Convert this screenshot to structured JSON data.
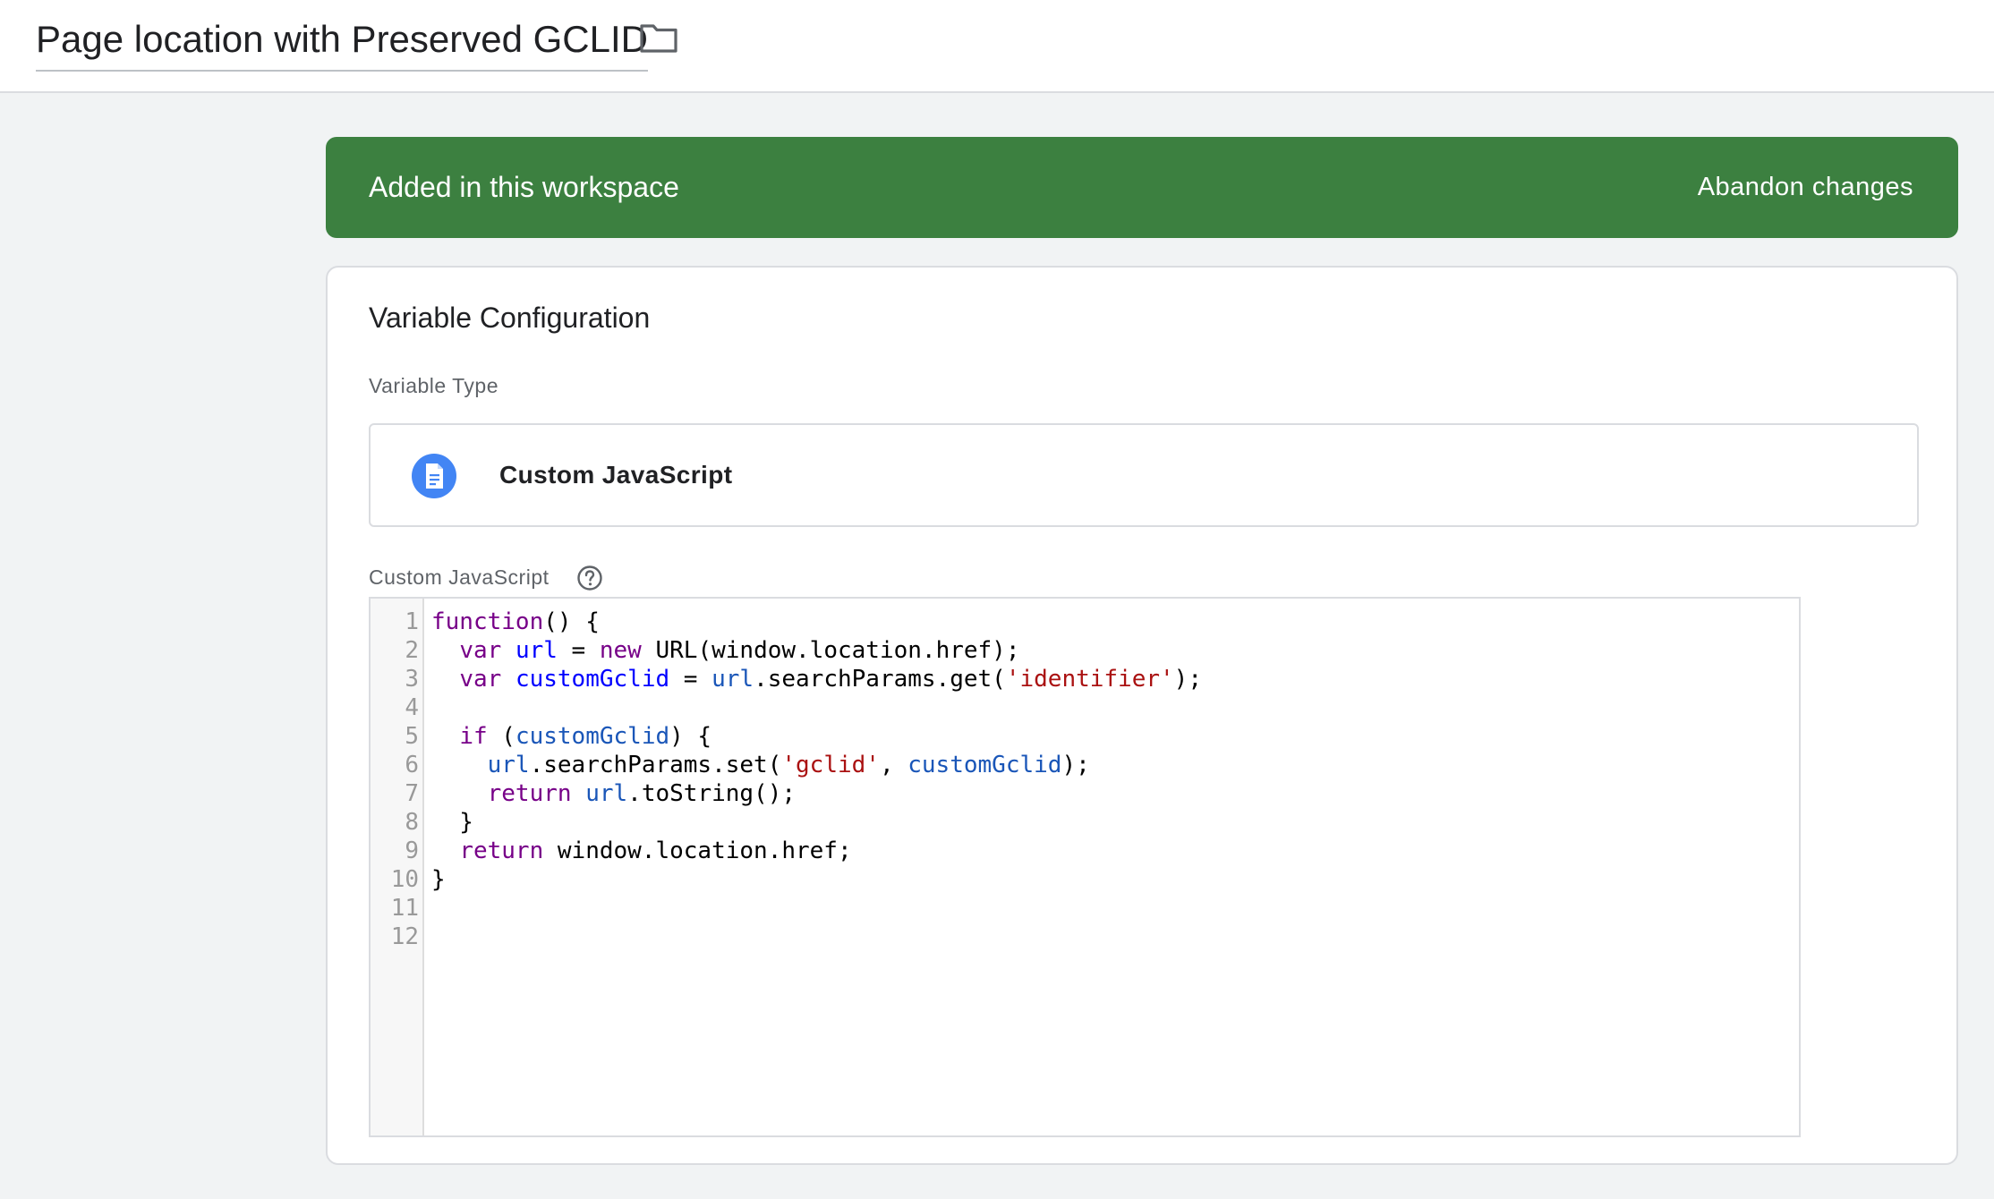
{
  "header": {
    "title": "Page location with Preserved GCLID",
    "folder_icon": "folder-icon"
  },
  "banner": {
    "status_text": "Added in this workspace",
    "abandon_label": "Abandon changes",
    "color": "#3c8040"
  },
  "config": {
    "title": "Variable Configuration",
    "type_label": "Variable Type",
    "type_name": "Custom JavaScript",
    "type_icon": "document-icon",
    "type_icon_color": "#4285f4",
    "js_label": "Custom JavaScript",
    "help_icon": "help-icon"
  },
  "editor": {
    "line_numbers": [
      "1",
      "2",
      "3",
      "4",
      "5",
      "6",
      "7",
      "8",
      "9",
      "10",
      "11",
      "12"
    ],
    "lines": [
      [
        [
          "keyword",
          "function"
        ],
        [
          "plain",
          "() {"
        ]
      ],
      [
        [
          "plain",
          "  "
        ],
        [
          "keyword",
          "var"
        ],
        [
          "plain",
          " "
        ],
        [
          "def",
          "url"
        ],
        [
          "plain",
          " = "
        ],
        [
          "keyword",
          "new"
        ],
        [
          "plain",
          " URL(window.location.href);"
        ]
      ],
      [
        [
          "plain",
          "  "
        ],
        [
          "keyword",
          "var"
        ],
        [
          "plain",
          " "
        ],
        [
          "def",
          "customGclid"
        ],
        [
          "plain",
          " = "
        ],
        [
          "variable",
          "url"
        ],
        [
          "plain",
          ".searchParams.get("
        ],
        [
          "string",
          "'identifier'"
        ],
        [
          "plain",
          ");"
        ]
      ],
      [],
      [
        [
          "plain",
          "  "
        ],
        [
          "keyword",
          "if"
        ],
        [
          "plain",
          " ("
        ],
        [
          "variable",
          "customGclid"
        ],
        [
          "plain",
          ") {"
        ]
      ],
      [
        [
          "plain",
          "    "
        ],
        [
          "variable",
          "url"
        ],
        [
          "plain",
          ".searchParams.set("
        ],
        [
          "string",
          "'gclid'"
        ],
        [
          "plain",
          ", "
        ],
        [
          "variable",
          "customGclid"
        ],
        [
          "plain",
          ");"
        ]
      ],
      [
        [
          "plain",
          "    "
        ],
        [
          "keyword",
          "return"
        ],
        [
          "plain",
          " "
        ],
        [
          "variable",
          "url"
        ],
        [
          "plain",
          ".toString();"
        ]
      ],
      [
        [
          "plain",
          "  }"
        ]
      ],
      [
        [
          "plain",
          "  "
        ],
        [
          "keyword",
          "return"
        ],
        [
          "plain",
          " window.location.href;"
        ]
      ],
      [
        [
          "plain",
          "}"
        ]
      ],
      [],
      []
    ]
  }
}
